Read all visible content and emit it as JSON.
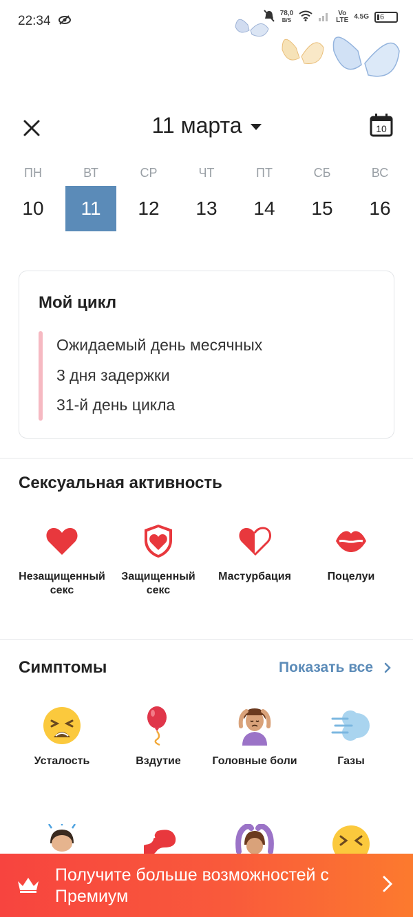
{
  "status_bar": {
    "time": "22:34",
    "net_speed_value": "78,0",
    "net_speed_unit": "B/S",
    "volte_top": "Vo",
    "volte_bottom": "LTE",
    "network": "4.5G",
    "battery": "6"
  },
  "header": {
    "title": "11 марта",
    "calendar_day": "10"
  },
  "week": {
    "days": [
      {
        "weekday": "ПН",
        "date": "10"
      },
      {
        "weekday": "ВТ",
        "date": "11"
      },
      {
        "weekday": "СР",
        "date": "12"
      },
      {
        "weekday": "ЧТ",
        "date": "13"
      },
      {
        "weekday": "ПТ",
        "date": "14"
      },
      {
        "weekday": "СБ",
        "date": "15"
      },
      {
        "weekday": "ВС",
        "date": "16"
      }
    ],
    "selected_index": 1
  },
  "cycle_card": {
    "title": "Мой цикл",
    "lines": [
      "Ожидаемый день месячных",
      "3 дня задержки",
      "31-й день цикла"
    ]
  },
  "sexual_activity": {
    "title": "Сексуальная активность",
    "items": [
      {
        "label_line1": "Незащищенный",
        "label_line2": "секс",
        "icon": "heart-icon"
      },
      {
        "label_line1": "Защищенный",
        "label_line2": "секс",
        "icon": "shield-heart-icon"
      },
      {
        "label_line1": "Мастурбация",
        "label_line2": "",
        "icon": "half-heart-icon"
      },
      {
        "label_line1": "Поцелуи",
        "label_line2": "",
        "icon": "lips-icon"
      }
    ]
  },
  "symptoms": {
    "title": "Симптомы",
    "show_all": "Показать все",
    "items": [
      {
        "label": "Усталость",
        "icon": "tired-face-icon"
      },
      {
        "label": "Вздутие",
        "icon": "balloon-icon"
      },
      {
        "label": "Головные боли",
        "icon": "headache-person-icon"
      },
      {
        "label": "Газы",
        "icon": "wind-icon"
      }
    ],
    "partial_row_icons": [
      "person-icon",
      "stomach-icon",
      "person-arms-up-icon",
      "confounded-face-icon"
    ]
  },
  "premium": {
    "text": "Получите больше возможностей с Премиум"
  },
  "colors": {
    "accent_blue": "#5b8bb8",
    "heart_red": "#e8383d",
    "cycle_bar_pink": "#f6b9c2",
    "premium_start": "#f7443f",
    "premium_end": "#fc7a2e"
  }
}
